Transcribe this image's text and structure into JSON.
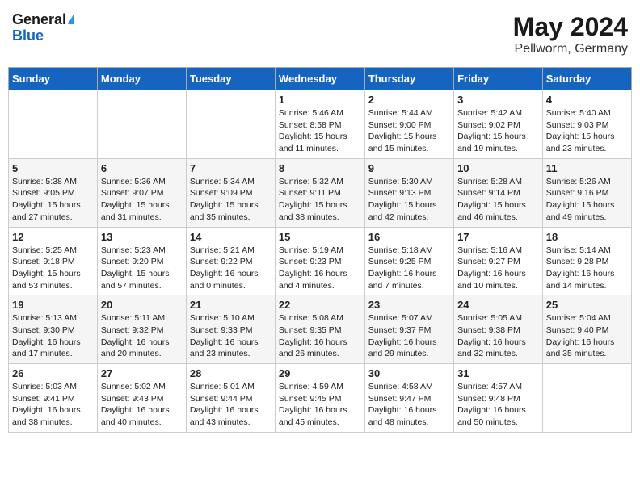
{
  "header": {
    "logo_general": "General",
    "logo_blue": "Blue",
    "month_year": "May 2024",
    "location": "Pellworm, Germany"
  },
  "weekdays": [
    "Sunday",
    "Monday",
    "Tuesday",
    "Wednesday",
    "Thursday",
    "Friday",
    "Saturday"
  ],
  "weeks": [
    [
      {
        "day": "",
        "info": ""
      },
      {
        "day": "",
        "info": ""
      },
      {
        "day": "",
        "info": ""
      },
      {
        "day": "1",
        "info": "Sunrise: 5:46 AM\nSunset: 8:58 PM\nDaylight: 15 hours\nand 11 minutes."
      },
      {
        "day": "2",
        "info": "Sunrise: 5:44 AM\nSunset: 9:00 PM\nDaylight: 15 hours\nand 15 minutes."
      },
      {
        "day": "3",
        "info": "Sunrise: 5:42 AM\nSunset: 9:02 PM\nDaylight: 15 hours\nand 19 minutes."
      },
      {
        "day": "4",
        "info": "Sunrise: 5:40 AM\nSunset: 9:03 PM\nDaylight: 15 hours\nand 23 minutes."
      }
    ],
    [
      {
        "day": "5",
        "info": "Sunrise: 5:38 AM\nSunset: 9:05 PM\nDaylight: 15 hours\nand 27 minutes."
      },
      {
        "day": "6",
        "info": "Sunrise: 5:36 AM\nSunset: 9:07 PM\nDaylight: 15 hours\nand 31 minutes."
      },
      {
        "day": "7",
        "info": "Sunrise: 5:34 AM\nSunset: 9:09 PM\nDaylight: 15 hours\nand 35 minutes."
      },
      {
        "day": "8",
        "info": "Sunrise: 5:32 AM\nSunset: 9:11 PM\nDaylight: 15 hours\nand 38 minutes."
      },
      {
        "day": "9",
        "info": "Sunrise: 5:30 AM\nSunset: 9:13 PM\nDaylight: 15 hours\nand 42 minutes."
      },
      {
        "day": "10",
        "info": "Sunrise: 5:28 AM\nSunset: 9:14 PM\nDaylight: 15 hours\nand 46 minutes."
      },
      {
        "day": "11",
        "info": "Sunrise: 5:26 AM\nSunset: 9:16 PM\nDaylight: 15 hours\nand 49 minutes."
      }
    ],
    [
      {
        "day": "12",
        "info": "Sunrise: 5:25 AM\nSunset: 9:18 PM\nDaylight: 15 hours\nand 53 minutes."
      },
      {
        "day": "13",
        "info": "Sunrise: 5:23 AM\nSunset: 9:20 PM\nDaylight: 15 hours\nand 57 minutes."
      },
      {
        "day": "14",
        "info": "Sunrise: 5:21 AM\nSunset: 9:22 PM\nDaylight: 16 hours\nand 0 minutes."
      },
      {
        "day": "15",
        "info": "Sunrise: 5:19 AM\nSunset: 9:23 PM\nDaylight: 16 hours\nand 4 minutes."
      },
      {
        "day": "16",
        "info": "Sunrise: 5:18 AM\nSunset: 9:25 PM\nDaylight: 16 hours\nand 7 minutes."
      },
      {
        "day": "17",
        "info": "Sunrise: 5:16 AM\nSunset: 9:27 PM\nDaylight: 16 hours\nand 10 minutes."
      },
      {
        "day": "18",
        "info": "Sunrise: 5:14 AM\nSunset: 9:28 PM\nDaylight: 16 hours\nand 14 minutes."
      }
    ],
    [
      {
        "day": "19",
        "info": "Sunrise: 5:13 AM\nSunset: 9:30 PM\nDaylight: 16 hours\nand 17 minutes."
      },
      {
        "day": "20",
        "info": "Sunrise: 5:11 AM\nSunset: 9:32 PM\nDaylight: 16 hours\nand 20 minutes."
      },
      {
        "day": "21",
        "info": "Sunrise: 5:10 AM\nSunset: 9:33 PM\nDaylight: 16 hours\nand 23 minutes."
      },
      {
        "day": "22",
        "info": "Sunrise: 5:08 AM\nSunset: 9:35 PM\nDaylight: 16 hours\nand 26 minutes."
      },
      {
        "day": "23",
        "info": "Sunrise: 5:07 AM\nSunset: 9:37 PM\nDaylight: 16 hours\nand 29 minutes."
      },
      {
        "day": "24",
        "info": "Sunrise: 5:05 AM\nSunset: 9:38 PM\nDaylight: 16 hours\nand 32 minutes."
      },
      {
        "day": "25",
        "info": "Sunrise: 5:04 AM\nSunset: 9:40 PM\nDaylight: 16 hours\nand 35 minutes."
      }
    ],
    [
      {
        "day": "26",
        "info": "Sunrise: 5:03 AM\nSunset: 9:41 PM\nDaylight: 16 hours\nand 38 minutes."
      },
      {
        "day": "27",
        "info": "Sunrise: 5:02 AM\nSunset: 9:43 PM\nDaylight: 16 hours\nand 40 minutes."
      },
      {
        "day": "28",
        "info": "Sunrise: 5:01 AM\nSunset: 9:44 PM\nDaylight: 16 hours\nand 43 minutes."
      },
      {
        "day": "29",
        "info": "Sunrise: 4:59 AM\nSunset: 9:45 PM\nDaylight: 16 hours\nand 45 minutes."
      },
      {
        "day": "30",
        "info": "Sunrise: 4:58 AM\nSunset: 9:47 PM\nDaylight: 16 hours\nand 48 minutes."
      },
      {
        "day": "31",
        "info": "Sunrise: 4:57 AM\nSunset: 9:48 PM\nDaylight: 16 hours\nand 50 minutes."
      },
      {
        "day": "",
        "info": ""
      }
    ]
  ]
}
